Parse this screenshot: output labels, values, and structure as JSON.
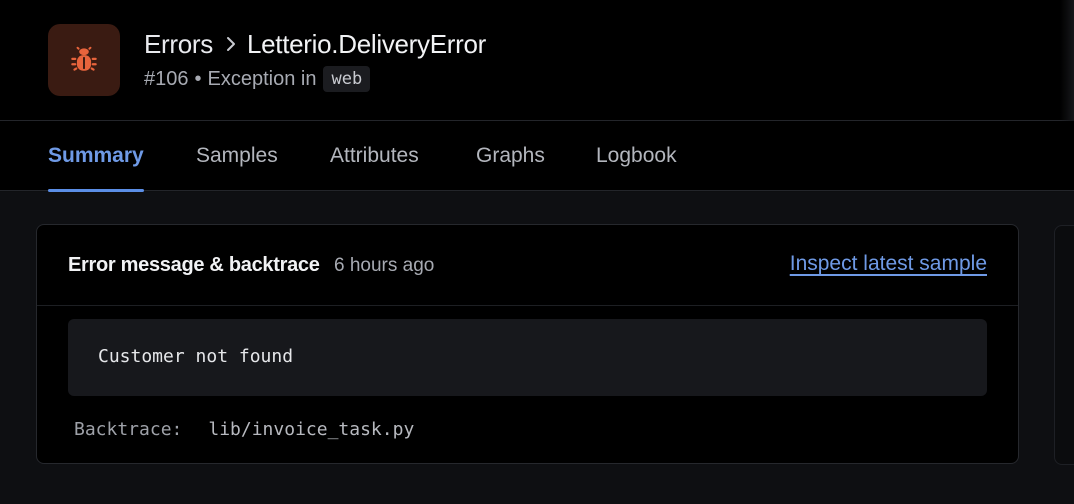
{
  "header": {
    "icon": "bug-icon",
    "breadcrumb": {
      "parent": "Errors",
      "current": "Letterio.DeliveryError"
    },
    "subline": {
      "number": "#106",
      "separator": "•",
      "text": "Exception in",
      "namespace": "web"
    }
  },
  "tabs": [
    {
      "label": "Summary",
      "active": true
    },
    {
      "label": "Samples",
      "active": false
    },
    {
      "label": "Attributes",
      "active": false
    },
    {
      "label": "Graphs",
      "active": false
    },
    {
      "label": "Logbook",
      "active": false
    }
  ],
  "card": {
    "title": "Error message & backtrace",
    "time": "6 hours ago",
    "link": "Inspect latest sample",
    "message": "Customer not found",
    "backtrace_label": "Backtrace:",
    "backtrace_file": "lib/invoice_task.py"
  },
  "colors": {
    "accent": "#6f9ae6",
    "icon_bg": "#3a1b12",
    "icon_fg": "#e8643c"
  }
}
